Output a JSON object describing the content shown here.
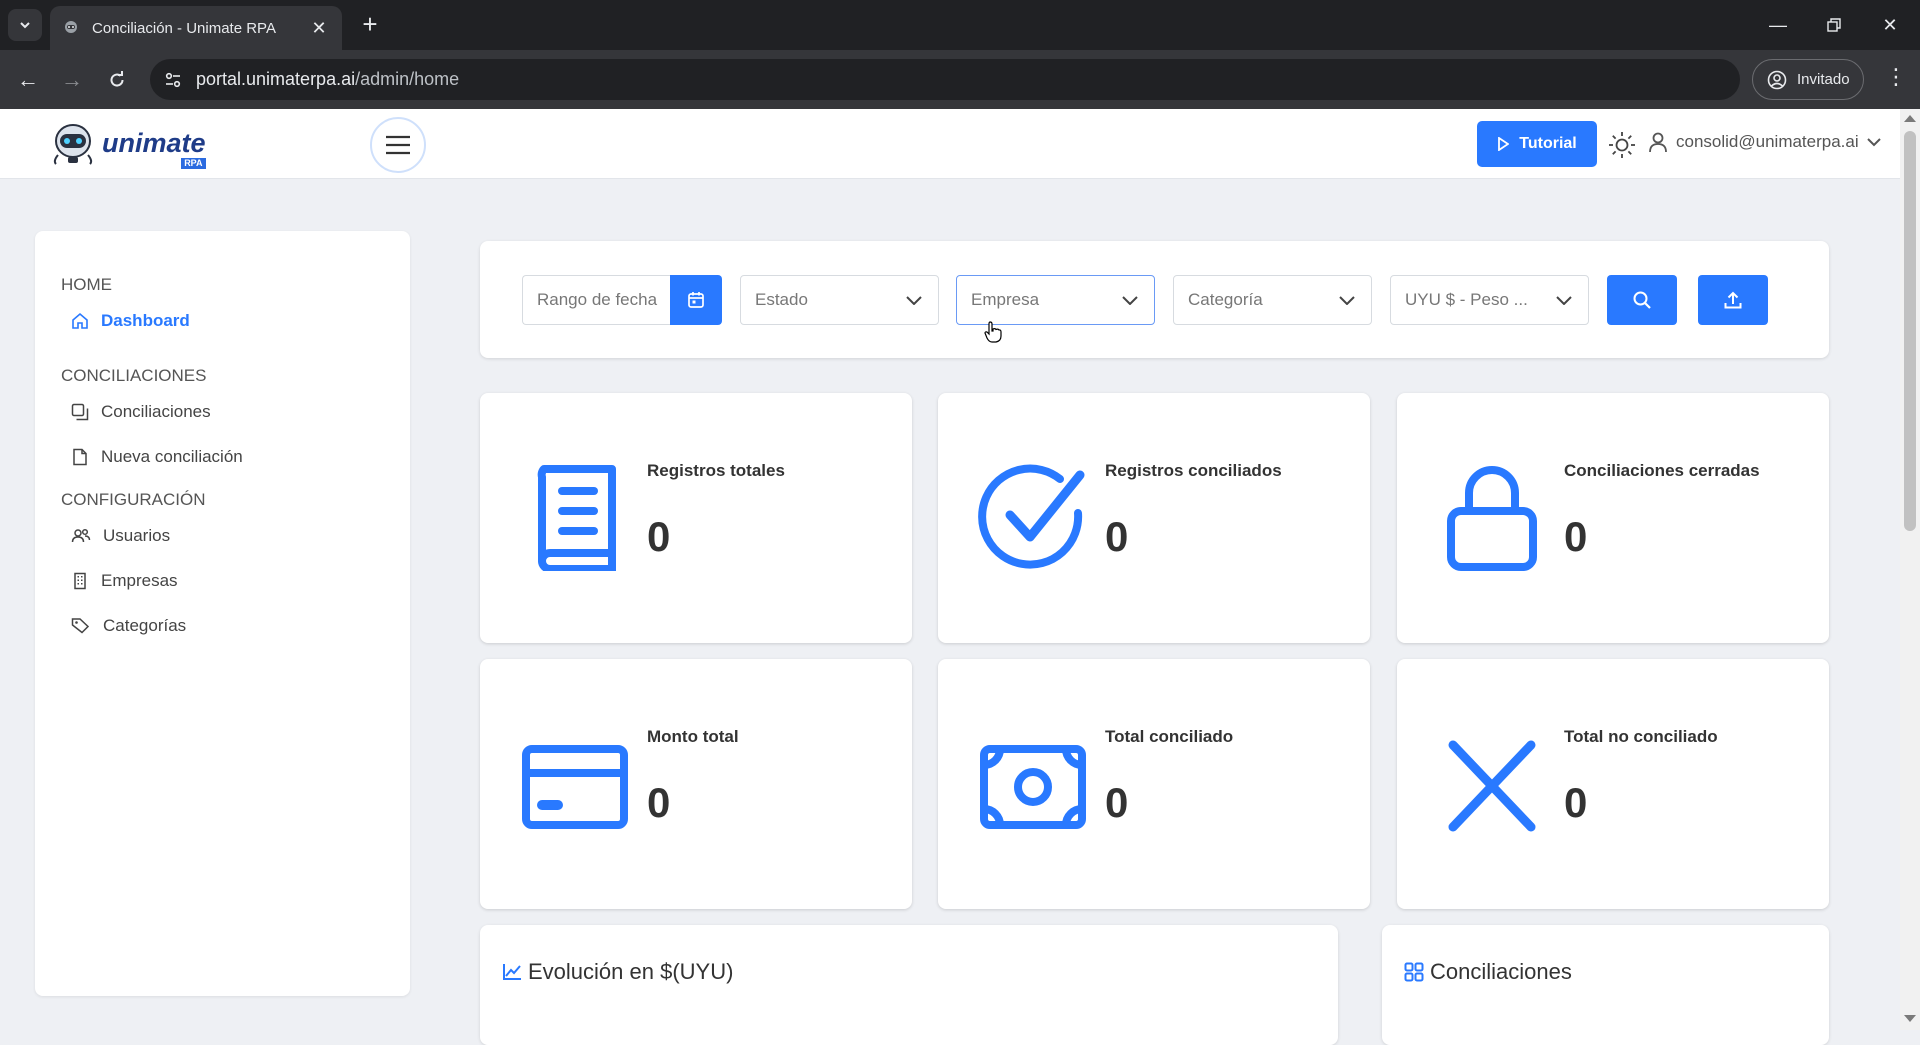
{
  "browser": {
    "tab_title": "Conciliación - Unimate RPA",
    "url_host": "portal.unimaterpa.ai",
    "url_path": "/admin/home",
    "profile_label": "Invitado"
  },
  "header": {
    "logo_text": "unimate",
    "logo_sub": "RPA",
    "tutorial_label": "Tutorial",
    "user_email": "consolid@unimaterpa.ai"
  },
  "sidebar": {
    "sections": [
      {
        "title": "HOME",
        "items": [
          {
            "label": "Dashboard",
            "icon": "home-icon",
            "active": true
          }
        ]
      },
      {
        "title": "CONCILIACIONES",
        "items": [
          {
            "label": "Conciliaciones",
            "icon": "copy-icon"
          },
          {
            "label": "Nueva conciliación",
            "icon": "file-icon"
          }
        ]
      },
      {
        "title": "CONFIGURACIÓN",
        "items": [
          {
            "label": "Usuarios",
            "icon": "users-icon"
          },
          {
            "label": "Empresas",
            "icon": "building-icon"
          },
          {
            "label": "Categorías",
            "icon": "tag-icon"
          }
        ]
      }
    ]
  },
  "filters": {
    "date_placeholder": "Rango de fecha",
    "estado": "Estado",
    "empresa": "Empresa",
    "categoria": "Categoría",
    "moneda": "UYU $ - Peso ..."
  },
  "cards": [
    {
      "label": "Registros totales",
      "value": "0",
      "icon": "book-icon"
    },
    {
      "label": "Registros conciliados",
      "value": "0",
      "icon": "check-circle-icon"
    },
    {
      "label": "Conciliaciones cerradas",
      "value": "0",
      "icon": "lock-icon"
    },
    {
      "label": "Monto total",
      "value": "0",
      "icon": "credit-card-icon"
    },
    {
      "label": "Total conciliado",
      "value": "0",
      "icon": "money-icon"
    },
    {
      "label": "Total no conciliado",
      "value": "0",
      "icon": "x-icon"
    }
  ],
  "panels": {
    "evolucion": "Evolución en $(UYU)",
    "conciliaciones": "Conciliaciones"
  },
  "colors": {
    "accent": "#2979ff"
  }
}
